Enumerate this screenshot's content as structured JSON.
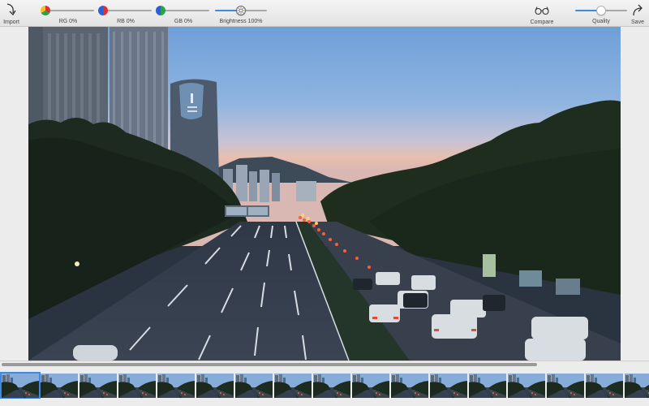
{
  "toolbar": {
    "import_label": "Import",
    "rg_label": "RG 0%",
    "rb_label": "RB 0%",
    "gb_label": "GB 0%",
    "brightness_label": "Brightness 100%",
    "compare_label": "Compare",
    "quality_label": "Quality",
    "save_label": "Save",
    "sliders": {
      "rg": 0,
      "rb": 0,
      "gb": 0,
      "brightness": 0.5,
      "quality": 0.5
    },
    "icons": {
      "import": "import-arrow-icon",
      "compare": "glasses-icon",
      "save": "save-arrow-icon"
    }
  },
  "colors": {
    "accent": "#3f8ae0",
    "toolbar_bg": "#e8e8e8",
    "window_bg": "#ececec"
  },
  "photo": {
    "subject": "city-highway-at-dusk"
  },
  "scroll": {
    "position": 0
  },
  "filmstrip": {
    "count": 17,
    "selected_index": 0
  }
}
